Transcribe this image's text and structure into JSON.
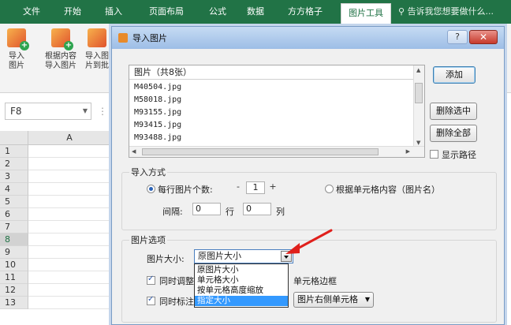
{
  "ribbon": {
    "tabs": [
      {
        "label": "文件",
        "active": false
      },
      {
        "label": "开始",
        "active": false
      },
      {
        "label": "插入",
        "active": false
      },
      {
        "label": "页面布局",
        "active": false
      },
      {
        "label": "公式",
        "active": false
      },
      {
        "label": "数据",
        "active": false
      },
      {
        "label": "方方格子",
        "active": false
      },
      {
        "label": "图片工具",
        "active": true
      }
    ],
    "tell_me": "告诉我您想要做什么...",
    "buttons": [
      {
        "label": "导入\n图片",
        "icon": "import-picture-icon"
      },
      {
        "label": "根据内容\n导入图片",
        "icon": "import-by-content-icon"
      },
      {
        "label": "导入图\n片到批",
        "icon": "import-to-comment-icon"
      }
    ],
    "accent_color": "#217346"
  },
  "formula_bar": {
    "name_box": "F8"
  },
  "grid": {
    "column_header": "A",
    "rows": [
      "1",
      "2",
      "3",
      "4",
      "5",
      "6",
      "7",
      "8",
      "9",
      "10",
      "11",
      "12",
      "13"
    ],
    "selected_row": "8"
  },
  "dialog": {
    "title": "导入图片",
    "help": "?",
    "close": "✕",
    "list_header": "图片（共8张）",
    "files": [
      "M40504.jpg",
      "M58018.jpg",
      "M93155.jpg",
      "M93415.jpg",
      "M93488.jpg"
    ],
    "buttons": {
      "add": "添加",
      "delete_selected": "删除选中",
      "delete_all": "删除全部"
    },
    "show_path": {
      "label": "显示路径",
      "checked": false
    },
    "import_mode": {
      "title": "导入方式",
      "per_row_label": "每行图片个数:",
      "per_row_value": "1",
      "minus": "-",
      "plus": "+",
      "per_row_selected": true,
      "by_content_label": "根据单元格内容（图片名）",
      "spacing_label": "间隔:",
      "spacing_rows_value": "0",
      "rows_unit": "行",
      "spacing_cols_value": "0",
      "cols_unit": "列"
    },
    "options": {
      "title": "图片选项",
      "size_label": "图片大小:",
      "size_value": "原图片大小",
      "size_options": [
        "原图片大小",
        "单元格大小",
        "按单元格高度缩放",
        "指定大小"
      ],
      "highlighted_option": "指定大小",
      "adjust_label_prefix": "同时调整",
      "adjust_label_suffix": "单元格边框",
      "adjust_checked": true,
      "mark_label_prefix": "同时标注",
      "mark_checked": true,
      "mark_position": "图片右侧单元格"
    }
  }
}
